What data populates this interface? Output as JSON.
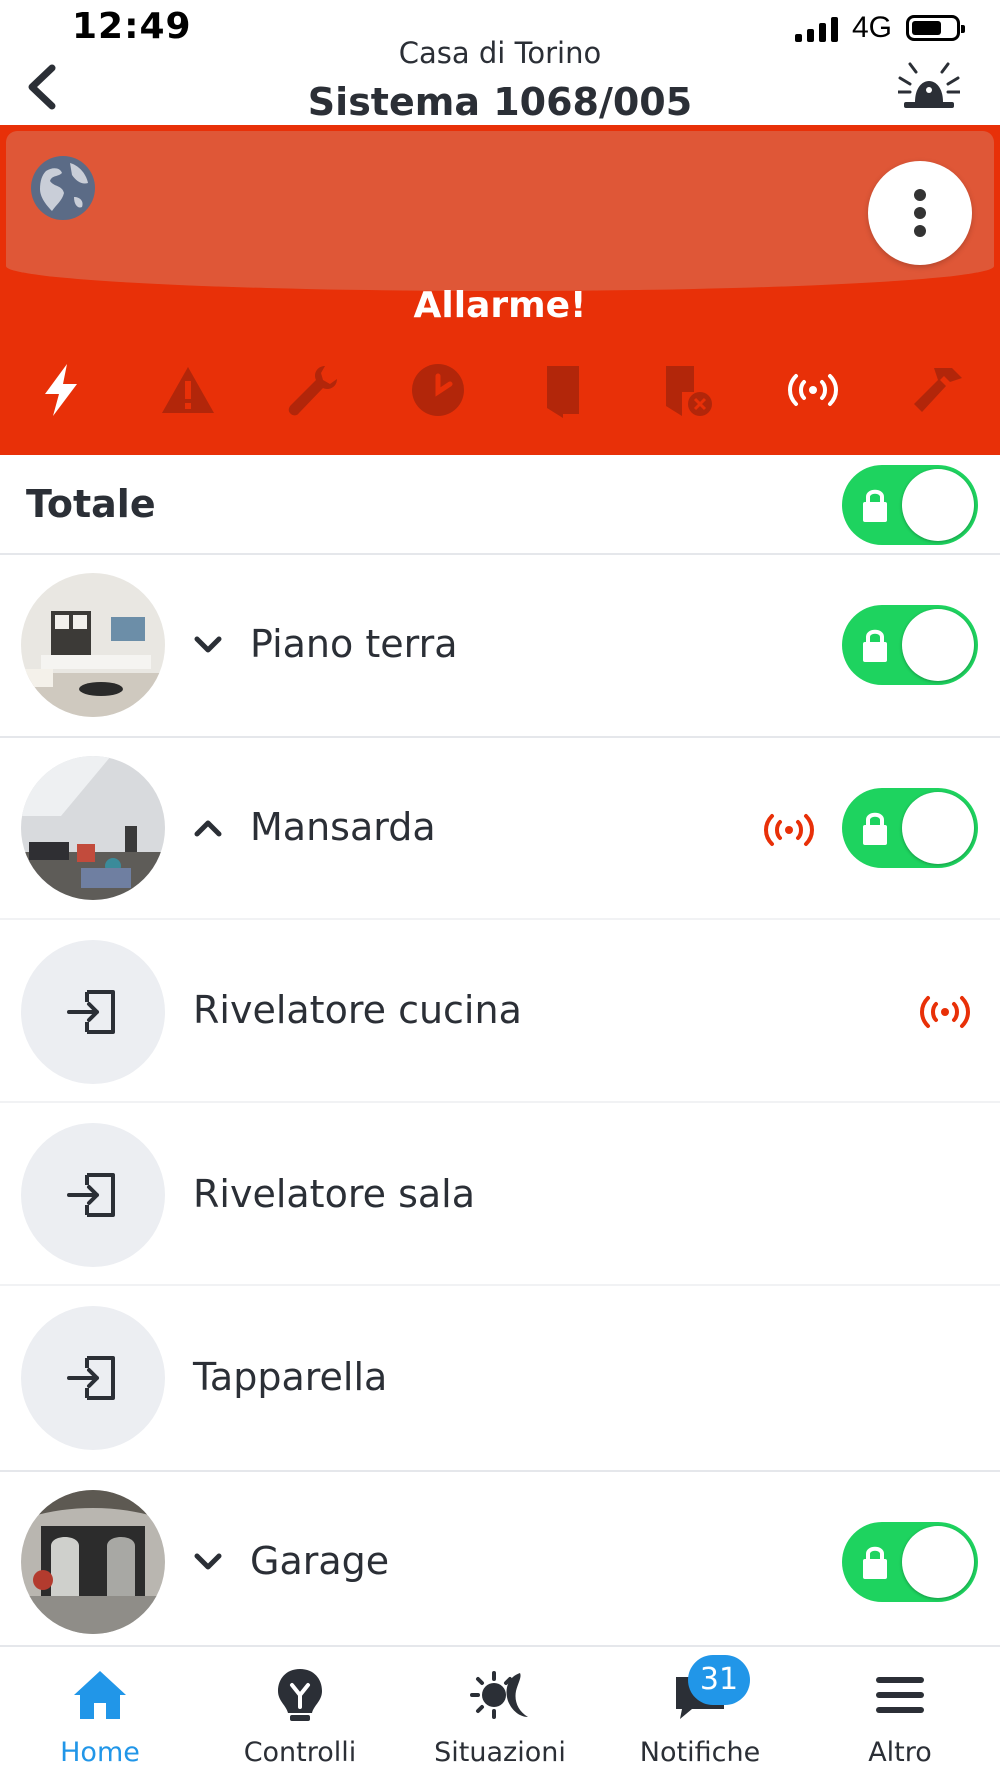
{
  "status_bar": {
    "time": "12:49",
    "network": "4G"
  },
  "header": {
    "subtitle": "Casa di Torino",
    "title": "Sistema 1068/005"
  },
  "banner": {
    "status_text": "Allarme!",
    "icons": [
      "power-bolt-icon",
      "warning-icon",
      "wrench-icon",
      "clock-icon",
      "door-icon",
      "door-excluded-icon",
      "radio-signal-icon",
      "hammer-icon"
    ]
  },
  "total": {
    "label": "Totale",
    "armed": true
  },
  "rows": [
    {
      "label": "Piano terra",
      "type": "area",
      "expanded": false,
      "armed": true
    },
    {
      "label": "Mansarda",
      "type": "area",
      "expanded": true,
      "armed": true,
      "alarm": true
    },
    {
      "label": "Rivelatore cucina",
      "type": "zone",
      "alarm": true
    },
    {
      "label": "Rivelatore sala",
      "type": "zone"
    },
    {
      "label": "Tapparella",
      "type": "zone"
    },
    {
      "label": "Garage",
      "type": "area",
      "expanded": false,
      "armed": true
    }
  ],
  "tabs": [
    {
      "label": "Home",
      "icon": "home-icon",
      "active": true
    },
    {
      "label": "Controlli",
      "icon": "bulb-icon"
    },
    {
      "label": "Situazioni",
      "icon": "sun-moon-icon"
    },
    {
      "label": "Notifiche",
      "icon": "chat-icon",
      "badge": "31"
    },
    {
      "label": "Altro",
      "icon": "menu-icon"
    }
  ],
  "colors": {
    "alarm_red": "#e83008",
    "toggle_green": "#1ed35f",
    "accent_blue": "#2196e8",
    "signal_red": "#e83008"
  }
}
